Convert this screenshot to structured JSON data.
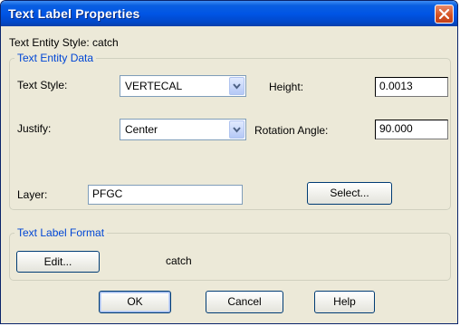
{
  "window": {
    "title": "Text Label Properties"
  },
  "entity_style": {
    "text": "Text Entity Style: catch"
  },
  "text_entity_data": {
    "legend": "Text Entity Data",
    "text_style_label": "Text Style:",
    "text_style_value": "VERTECAL",
    "height_label": "Height:",
    "height_value": "0.0013",
    "justify_label": "Justify:",
    "justify_value": "Center",
    "rotation_label": "Rotation Angle:",
    "rotation_value": "90.000",
    "layer_label": "Layer:",
    "layer_value": "PFGC",
    "select_button": "Select..."
  },
  "text_label_format": {
    "legend": "Text Label Format",
    "edit_button": "Edit...",
    "format_value": "catch"
  },
  "buttons": {
    "ok": "OK",
    "cancel": "Cancel",
    "help": "Help"
  },
  "icons": {
    "close": "close-icon",
    "dropdown": "chevron-down-icon"
  },
  "colors": {
    "title_bar": "#0055e5",
    "group_legend": "#0046d5",
    "close_button": "#d4501f"
  }
}
